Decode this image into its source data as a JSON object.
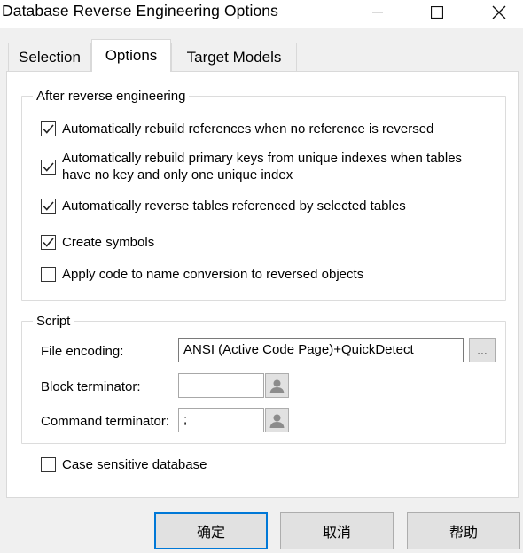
{
  "window": {
    "title": "Database Reverse Engineering Options"
  },
  "tabs": [
    {
      "label": "Selection",
      "active": false
    },
    {
      "label": "Options",
      "active": true
    },
    {
      "label": "Target Models",
      "active": false
    }
  ],
  "after_reverse": {
    "legend": "After reverse engineering",
    "options": [
      {
        "label": "Automatically rebuild references when no reference is reversed",
        "checked": true
      },
      {
        "label_line1": "Automatically rebuild primary keys from unique indexes when tables",
        "label_line2": "have no key and only one unique index",
        "checked": true
      },
      {
        "label": "Automatically reverse tables referenced by selected tables",
        "checked": true
      },
      {
        "label": "Create symbols",
        "checked": true
      },
      {
        "label": "Apply code to name conversion to reversed objects",
        "checked": false
      }
    ]
  },
  "script": {
    "legend": "Script",
    "file_encoding_label": "File encoding:",
    "file_encoding_value": "ANSI (Active Code Page)+QuickDetect",
    "browse_label": "...",
    "block_terminator_label": "Block terminator:",
    "block_terminator_value": "",
    "command_terminator_label": "Command terminator:",
    "command_terminator_value": ";"
  },
  "case_sensitive": {
    "label": "Case sensitive database",
    "checked": false
  },
  "buttons": {
    "ok": "确定",
    "cancel": "取消",
    "help": "帮助"
  },
  "colors": {
    "title_bar": "#ffffff",
    "dialog_bg": "#f0f0f0",
    "panel_bg": "#ffffff",
    "default_button_border": "#0078d7"
  },
  "icons": [
    "minimize-icon",
    "maximize-icon",
    "close-icon",
    "checkmark-icon",
    "user-icon"
  ]
}
